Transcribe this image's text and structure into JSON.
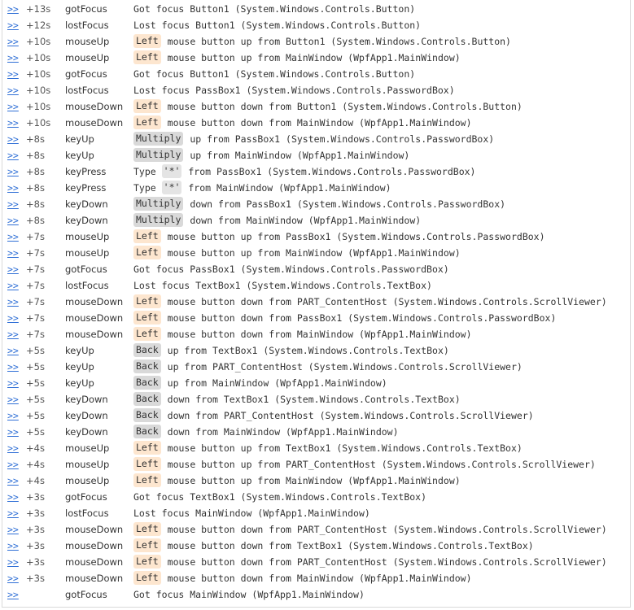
{
  "link_text": ">>",
  "colors": {
    "link": "#2f6fd6",
    "mouse_badge": "#fde6cf",
    "key_badge": "#d9d9d9",
    "border": "#d9d9d9"
  },
  "rows": [
    {
      "time": "+13s",
      "event": "gotFocus",
      "pre": "",
      "badge": "",
      "badge_kind": "",
      "text": "Got focus Button1 (System.Windows.Controls.Button)"
    },
    {
      "time": "+12s",
      "event": "lostFocus",
      "pre": "",
      "badge": "",
      "badge_kind": "",
      "text": "Lost focus Button1 (System.Windows.Controls.Button)"
    },
    {
      "time": "+10s",
      "event": "mouseUp",
      "pre": "",
      "badge": "Left",
      "badge_kind": "mouse",
      "text": "mouse button up from Button1 (System.Windows.Controls.Button)"
    },
    {
      "time": "+10s",
      "event": "mouseUp",
      "pre": "",
      "badge": "Left",
      "badge_kind": "mouse",
      "text": "mouse button up from MainWindow (WpfApp1.MainWindow)"
    },
    {
      "time": "+10s",
      "event": "gotFocus",
      "pre": "",
      "badge": "",
      "badge_kind": "",
      "text": "Got focus Button1 (System.Windows.Controls.Button)"
    },
    {
      "time": "+10s",
      "event": "lostFocus",
      "pre": "",
      "badge": "",
      "badge_kind": "",
      "text": "Lost focus PassBox1 (System.Windows.Controls.PasswordBox)"
    },
    {
      "time": "+10s",
      "event": "mouseDown",
      "pre": "",
      "badge": "Left",
      "badge_kind": "mouse",
      "text": "mouse button down from Button1 (System.Windows.Controls.Button)"
    },
    {
      "time": "+10s",
      "event": "mouseDown",
      "pre": "",
      "badge": "Left",
      "badge_kind": "mouse",
      "text": "mouse button down from MainWindow (WpfApp1.MainWindow)"
    },
    {
      "time": "+8s",
      "event": "keyUp",
      "pre": "",
      "badge": "Multiply",
      "badge_kind": "key",
      "text": "up from PassBox1 (System.Windows.Controls.PasswordBox)"
    },
    {
      "time": "+8s",
      "event": "keyUp",
      "pre": "",
      "badge": "Multiply",
      "badge_kind": "key",
      "text": "up from MainWindow (WpfApp1.MainWindow)"
    },
    {
      "time": "+8s",
      "event": "keyPress",
      "pre": "Type",
      "badge": "'*'",
      "badge_kind": "char",
      "text": "from PassBox1 (System.Windows.Controls.PasswordBox)"
    },
    {
      "time": "+8s",
      "event": "keyPress",
      "pre": "Type",
      "badge": "'*'",
      "badge_kind": "char",
      "text": "from MainWindow (WpfApp1.MainWindow)"
    },
    {
      "time": "+8s",
      "event": "keyDown",
      "pre": "",
      "badge": "Multiply",
      "badge_kind": "key",
      "text": "down from PassBox1 (System.Windows.Controls.PasswordBox)"
    },
    {
      "time": "+8s",
      "event": "keyDown",
      "pre": "",
      "badge": "Multiply",
      "badge_kind": "key",
      "text": "down from MainWindow (WpfApp1.MainWindow)"
    },
    {
      "time": "+7s",
      "event": "mouseUp",
      "pre": "",
      "badge": "Left",
      "badge_kind": "mouse",
      "text": "mouse button up from PassBox1 (System.Windows.Controls.PasswordBox)"
    },
    {
      "time": "+7s",
      "event": "mouseUp",
      "pre": "",
      "badge": "Left",
      "badge_kind": "mouse",
      "text": "mouse button up from MainWindow (WpfApp1.MainWindow)"
    },
    {
      "time": "+7s",
      "event": "gotFocus",
      "pre": "",
      "badge": "",
      "badge_kind": "",
      "text": "Got focus PassBox1 (System.Windows.Controls.PasswordBox)"
    },
    {
      "time": "+7s",
      "event": "lostFocus",
      "pre": "",
      "badge": "",
      "badge_kind": "",
      "text": "Lost focus TextBox1 (System.Windows.Controls.TextBox)"
    },
    {
      "time": "+7s",
      "event": "mouseDown",
      "pre": "",
      "badge": "Left",
      "badge_kind": "mouse",
      "text": "mouse button down from PART_ContentHost (System.Windows.Controls.ScrollViewer)"
    },
    {
      "time": "+7s",
      "event": "mouseDown",
      "pre": "",
      "badge": "Left",
      "badge_kind": "mouse",
      "text": "mouse button down from PassBox1 (System.Windows.Controls.PasswordBox)"
    },
    {
      "time": "+7s",
      "event": "mouseDown",
      "pre": "",
      "badge": "Left",
      "badge_kind": "mouse",
      "text": "mouse button down from MainWindow (WpfApp1.MainWindow)"
    },
    {
      "time": "+5s",
      "event": "keyUp",
      "pre": "",
      "badge": "Back",
      "badge_kind": "key",
      "text": "up from TextBox1 (System.Windows.Controls.TextBox)"
    },
    {
      "time": "+5s",
      "event": "keyUp",
      "pre": "",
      "badge": "Back",
      "badge_kind": "key",
      "text": "up from PART_ContentHost (System.Windows.Controls.ScrollViewer)"
    },
    {
      "time": "+5s",
      "event": "keyUp",
      "pre": "",
      "badge": "Back",
      "badge_kind": "key",
      "text": "up from MainWindow (WpfApp1.MainWindow)"
    },
    {
      "time": "+5s",
      "event": "keyDown",
      "pre": "",
      "badge": "Back",
      "badge_kind": "key",
      "text": "down from TextBox1 (System.Windows.Controls.TextBox)"
    },
    {
      "time": "+5s",
      "event": "keyDown",
      "pre": "",
      "badge": "Back",
      "badge_kind": "key",
      "text": "down from PART_ContentHost (System.Windows.Controls.ScrollViewer)"
    },
    {
      "time": "+5s",
      "event": "keyDown",
      "pre": "",
      "badge": "Back",
      "badge_kind": "key",
      "text": "down from MainWindow (WpfApp1.MainWindow)"
    },
    {
      "time": "+4s",
      "event": "mouseUp",
      "pre": "",
      "badge": "Left",
      "badge_kind": "mouse",
      "text": "mouse button up from TextBox1 (System.Windows.Controls.TextBox)"
    },
    {
      "time": "+4s",
      "event": "mouseUp",
      "pre": "",
      "badge": "Left",
      "badge_kind": "mouse",
      "text": "mouse button up from PART_ContentHost (System.Windows.Controls.ScrollViewer)"
    },
    {
      "time": "+4s",
      "event": "mouseUp",
      "pre": "",
      "badge": "Left",
      "badge_kind": "mouse",
      "text": "mouse button up from MainWindow (WpfApp1.MainWindow)"
    },
    {
      "time": "+3s",
      "event": "gotFocus",
      "pre": "",
      "badge": "",
      "badge_kind": "",
      "text": "Got focus TextBox1 (System.Windows.Controls.TextBox)"
    },
    {
      "time": "+3s",
      "event": "lostFocus",
      "pre": "",
      "badge": "",
      "badge_kind": "",
      "text": "Lost focus MainWindow (WpfApp1.MainWindow)"
    },
    {
      "time": "+3s",
      "event": "mouseDown",
      "pre": "",
      "badge": "Left",
      "badge_kind": "mouse",
      "text": "mouse button down from PART_ContentHost (System.Windows.Controls.ScrollViewer)"
    },
    {
      "time": "+3s",
      "event": "mouseDown",
      "pre": "",
      "badge": "Left",
      "badge_kind": "mouse",
      "text": "mouse button down from TextBox1 (System.Windows.Controls.TextBox)"
    },
    {
      "time": "+3s",
      "event": "mouseDown",
      "pre": "",
      "badge": "Left",
      "badge_kind": "mouse",
      "text": "mouse button down from PART_ContentHost (System.Windows.Controls.ScrollViewer)"
    },
    {
      "time": "+3s",
      "event": "mouseDown",
      "pre": "",
      "badge": "Left",
      "badge_kind": "mouse",
      "text": "mouse button down from MainWindow (WpfApp1.MainWindow)"
    },
    {
      "time": "",
      "event": "gotFocus",
      "pre": "",
      "badge": "",
      "badge_kind": "",
      "text": "Got focus MainWindow (WpfApp1.MainWindow)"
    }
  ]
}
